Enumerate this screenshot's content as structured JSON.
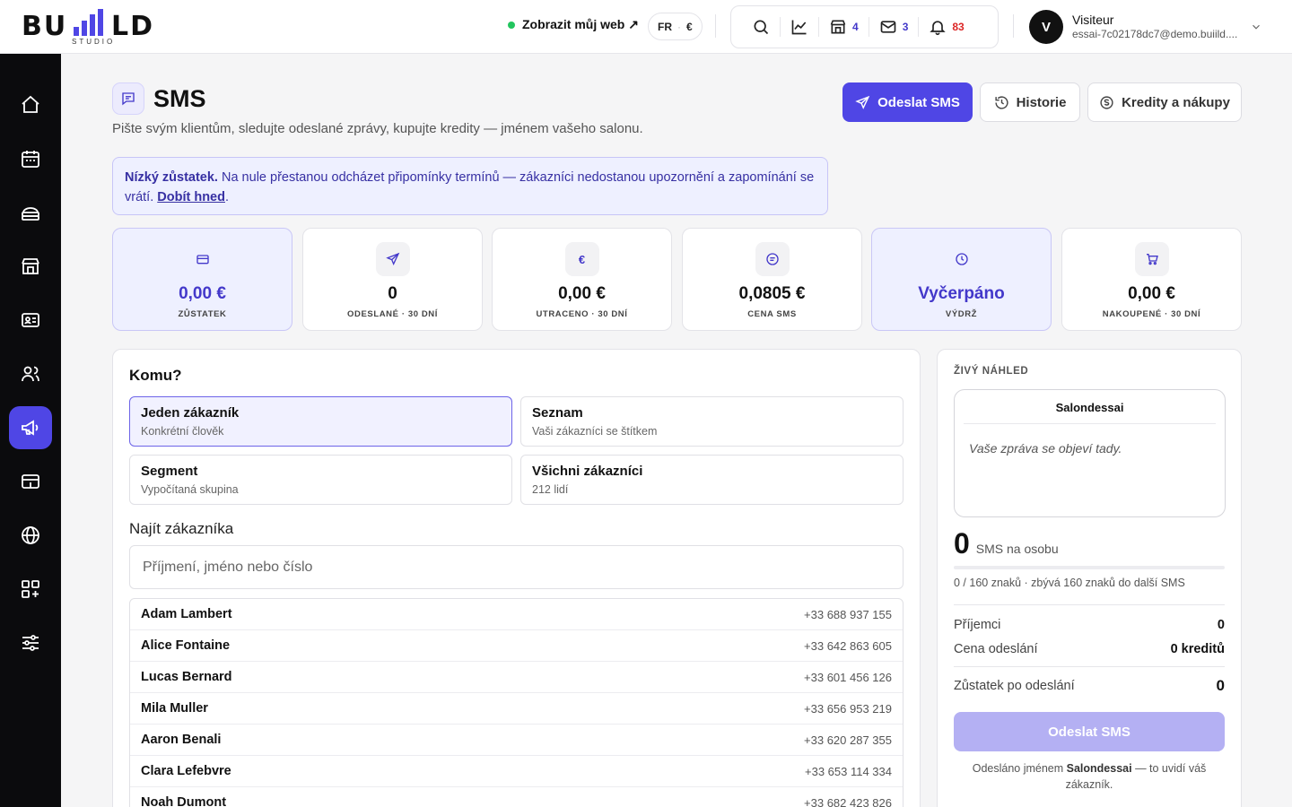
{
  "brand": {
    "name": "BUILD",
    "sub": "STUDIO",
    "accent": "#4f46e5"
  },
  "topbar": {
    "site_link": "Zobrazit můj web ↗",
    "lang": "FR",
    "currency": "€",
    "counts": {
      "store": "4",
      "mail": "3",
      "bell": "83"
    },
    "user": {
      "initial": "V",
      "name": "Visiteur",
      "email": "essai-7c02178dc7@demo.buiild...."
    }
  },
  "sidebar": {
    "items": [
      {
        "name": "home-icon",
        "active": false
      },
      {
        "name": "calendar-icon",
        "active": false
      },
      {
        "name": "services-icon",
        "active": false
      },
      {
        "name": "store-icon",
        "active": false
      },
      {
        "name": "contact-card-icon",
        "active": false
      },
      {
        "name": "users-icon",
        "active": false
      },
      {
        "name": "megaphone-icon",
        "active": true
      },
      {
        "name": "payments-icon",
        "active": false
      },
      {
        "name": "globe-icon",
        "active": false
      },
      {
        "name": "apps-icon",
        "active": false
      },
      {
        "name": "settings-sliders-icon",
        "active": false
      }
    ]
  },
  "header": {
    "title": "SMS",
    "subtitle": "Pište svým klientům, sledujte odeslané zprávy, kupujte kredity — jménem vašeho salonu.",
    "buttons": {
      "send": "Odeslat SMS",
      "history": "Historie",
      "credits": "Kredity a nákupy"
    }
  },
  "alert": {
    "strong": "Nízký zůstatek.",
    "text": " Na nule přestanou odcházet připomínky termínů — zákazníci nedostanou upozornění a zapomínání se vrátí. ",
    "link": "Dobít hned",
    "end": "."
  },
  "stats": [
    {
      "icon": "credit-card-icon",
      "value": "0,00 €",
      "label": "ZŮSTATEK",
      "highlight": true
    },
    {
      "icon": "send-icon",
      "value": "0",
      "label": "ODESLANÉ · 30 DNÍ",
      "highlight": false
    },
    {
      "icon": "euro-icon",
      "value": "0,00 €",
      "label": "UTRACENO · 30 DNÍ",
      "highlight": false
    },
    {
      "icon": "message-circle-icon",
      "value": "0,0805 €",
      "label": "CENA SMS",
      "highlight": false
    },
    {
      "icon": "clock-icon",
      "value": "Vyčerpáno",
      "label": "VÝDRŽ",
      "highlight": true
    },
    {
      "icon": "cart-icon",
      "value": "0,00 €",
      "label": "NAKOUPENÉ · 30 DNÍ",
      "highlight": false
    }
  ],
  "recipients": {
    "title": "Komu?",
    "options": [
      {
        "title": "Jeden zákazník",
        "sub": "Konkrétní člověk",
        "selected": true
      },
      {
        "title": "Seznam",
        "sub": "Vaši zákazníci se štítkem",
        "selected": false
      },
      {
        "title": "Segment",
        "sub": "Vypočítaná skupina",
        "selected": false
      },
      {
        "title": "Všichni zákazníci",
        "sub": "212 lidí",
        "selected": false
      }
    ],
    "find_label": "Najít zákazníka",
    "search_placeholder": "Příjmení, jméno nebo číslo",
    "customers": [
      {
        "name": "Adam Lambert",
        "phone": "+33 688 937 155"
      },
      {
        "name": "Alice Fontaine",
        "phone": "+33 642 863 605"
      },
      {
        "name": "Lucas Bernard",
        "phone": "+33 601 456 126"
      },
      {
        "name": "Mila Muller",
        "phone": "+33 656 953 219"
      },
      {
        "name": "Aaron Benali",
        "phone": "+33 620 287 355"
      },
      {
        "name": "Clara Lefebvre",
        "phone": "+33 653 114 334"
      },
      {
        "name": "Noah Dumont",
        "phone": "+33 682 423 826"
      }
    ]
  },
  "preview": {
    "label": "ŽIVÝ NÁHLED",
    "sender": "Salondessai",
    "placeholder": "Vaše zpráva se objeví tady.",
    "sms_count": "0",
    "sms_count_label": "SMS na osobu",
    "progress": 0,
    "chars": "0 / 160 znaků · zbývá 160 znaků do další SMS",
    "recipients_label": "Příjemci",
    "recipients_value": "0",
    "cost_label": "Cena odeslání",
    "cost_value": "0 kreditů",
    "balance_label": "Zůstatek po odeslání",
    "balance_value": "0",
    "send_button": "Odeslat SMS",
    "sent_as_prefix": "Odesláno jménem ",
    "sent_as_name": "Salondessai",
    "sent_as_suffix": " — to uvidí váš zákazník."
  }
}
